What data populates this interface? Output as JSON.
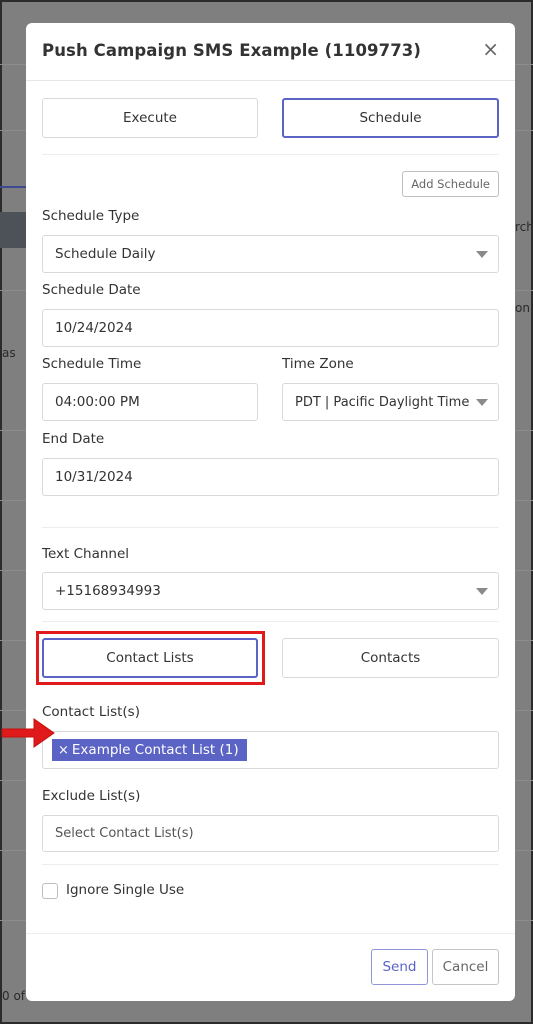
{
  "background": {
    "fragment_right_1": "rch",
    "fragment_right_2": "on",
    "fragment_left_1": "as",
    "fragment_bottom": "0 of"
  },
  "modal": {
    "title": "Push Campaign SMS Example (1109773)",
    "close_glyph": "×",
    "mode_tabs": [
      {
        "label": "Execute",
        "active": false
      },
      {
        "label": "Schedule",
        "active": true
      }
    ],
    "add_schedule_label": "Add Schedule",
    "schedule_type": {
      "label": "Schedule Type",
      "value": "Schedule Daily"
    },
    "schedule_date": {
      "label": "Schedule Date",
      "value": "10/24/2024"
    },
    "schedule_time": {
      "label": "Schedule Time",
      "value": "04:00:00 PM"
    },
    "time_zone": {
      "label": "Time Zone",
      "value": "PDT | Pacific Daylight Time"
    },
    "end_date": {
      "label": "End Date",
      "value": "10/31/2024"
    },
    "text_channel": {
      "label": "Text Channel",
      "value": "+15168934993"
    },
    "recipient_tabs": [
      {
        "label": "Contact Lists",
        "active": true
      },
      {
        "label": "Contacts",
        "active": false
      }
    ],
    "contact_lists": {
      "label": "Contact List(s)",
      "selected": [
        {
          "remove_glyph": "×",
          "name": "Example Contact List (1)"
        }
      ]
    },
    "exclude_lists": {
      "label": "Exclude List(s)",
      "placeholder": "Select Contact List(s)"
    },
    "ignore_single_use": {
      "label": "Ignore Single Use",
      "checked": false
    },
    "footer": {
      "send_label": "Send",
      "cancel_label": "Cancel"
    }
  },
  "colors": {
    "accent": "#5b63c4",
    "highlight": "#e01a1a",
    "overlay": "#7f7f7f"
  }
}
